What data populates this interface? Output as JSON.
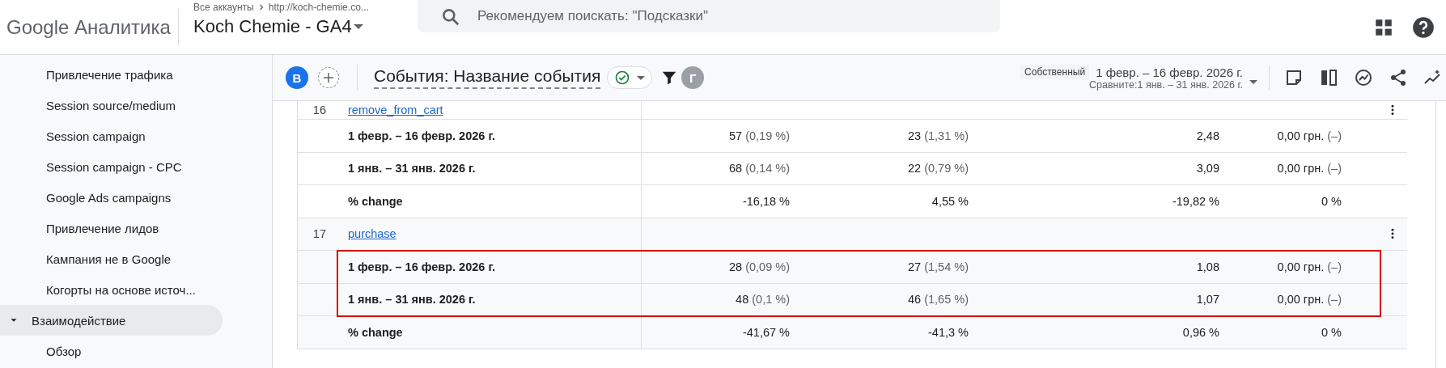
{
  "header": {
    "logo": "Google Аналитика",
    "breadcrumb": [
      "Все аккаунты",
      "http://koch-chemie.co..."
    ],
    "property": "Koch Chemie - GA4",
    "search": {
      "placeholder": "Рекомендуем поискать: \"Подсказки\""
    }
  },
  "sidebar": {
    "items": [
      {
        "label": "Привлечение трафика",
        "selected": false
      },
      {
        "label": "Session source/medium",
        "selected": false
      },
      {
        "label": "Session campaign",
        "selected": false
      },
      {
        "label": "Session campaign - CPC",
        "selected": false
      },
      {
        "label": "Google Ads campaigns",
        "selected": false
      },
      {
        "label": "Привлечение лидов",
        "selected": false
      },
      {
        "label": "Кампания не в Google",
        "selected": false
      },
      {
        "label": "Когорты на основе источ...",
        "selected": false
      },
      {
        "label": "Взаимодействие",
        "selected": true,
        "expanded": true,
        "children": [
          {
            "label": "Обзор",
            "selected": false
          }
        ]
      }
    ]
  },
  "toolbar": {
    "segment_badge": "B",
    "title": "События: Название события",
    "comparison_badge": "Г",
    "date_type": "Собственный",
    "date_range": "1 февр. – 16 февр. 2026 г.",
    "compare_range": "Сравните:1 янв. – 31 янв. 2026 г."
  },
  "table": {
    "groups": [
      {
        "rank": "16",
        "event": "remove_from_cart",
        "rows": [
          {
            "label": "1 февр. – 16 февр. 2026 г.",
            "highlighted": false,
            "cells": [
              {
                "value": "57",
                "share": "(0,19 %)"
              },
              {
                "value": "23",
                "share": "(1,31 %)"
              },
              {
                "value": "2,48"
              },
              {
                "value": "0,00 грн.",
                "share": "(–)"
              }
            ]
          },
          {
            "label": "1 янв. – 31 янв. 2026 г.",
            "highlighted": false,
            "cells": [
              {
                "value": "68",
                "share": "(0,14 %)"
              },
              {
                "value": "22",
                "share": "(0,79 %)"
              },
              {
                "value": "3,09"
              },
              {
                "value": "0,00 грн.",
                "share": "(–)"
              }
            ]
          },
          {
            "label": "% change",
            "highlighted": false,
            "cells": [
              {
                "value": "-16,18 %"
              },
              {
                "value": "4,55 %"
              },
              {
                "value": "-19,82 %"
              },
              {
                "value": "0 %"
              }
            ]
          }
        ]
      },
      {
        "rank": "17",
        "event": "purchase",
        "rows": [
          {
            "label": "1 февр. – 16 февр. 2026 г.",
            "highlighted": true,
            "cells": [
              {
                "value": "28",
                "share": "(0,09 %)"
              },
              {
                "value": "27",
                "share": "(1,54 %)"
              },
              {
                "value": "1,08"
              },
              {
                "value": "0,00 грн.",
                "share": "(–)"
              }
            ]
          },
          {
            "label": "1 янв. – 31 янв. 2026 г.",
            "highlighted": true,
            "cells": [
              {
                "value": "48",
                "share": "(0,1 %)"
              },
              {
                "value": "46",
                "share": "(1,65 %)"
              },
              {
                "value": "1,07"
              },
              {
                "value": "0,00 грн.",
                "share": "(–)"
              }
            ]
          },
          {
            "label": "% change",
            "highlighted": false,
            "cells": [
              {
                "value": "-41,67 %"
              },
              {
                "value": "-41,3 %"
              },
              {
                "value": "0,96 %"
              },
              {
                "value": "0 %"
              }
            ]
          }
        ]
      }
    ]
  }
}
